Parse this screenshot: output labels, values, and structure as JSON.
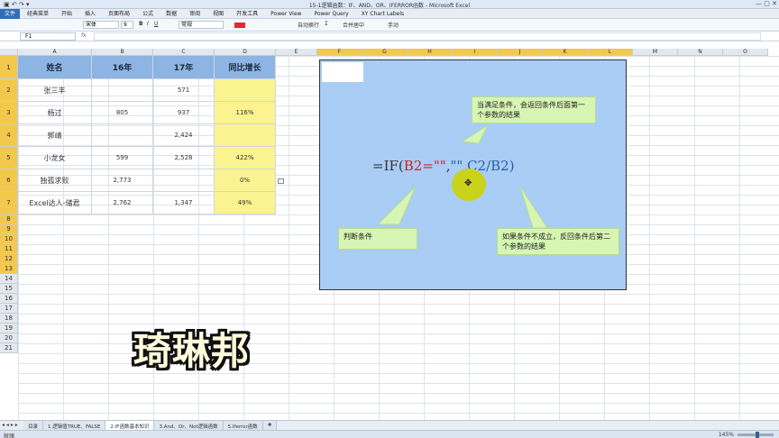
{
  "window": {
    "title": "15-1逻辑函数：IF、AND、OR、IFERROR函数 - Microsoft Excel",
    "quick_access": "▣ ↶ ↷ ▾",
    "controls": "— ▢ ✕"
  },
  "menu": {
    "file": "文件",
    "tabs": [
      "经典菜单",
      "开始",
      "插入",
      "页面布局",
      "公式",
      "数据",
      "审阅",
      "视图",
      "开发工具",
      "Power View",
      "Power Query",
      "XY Chart Labels"
    ]
  },
  "ribbon": {
    "font_name": "宋体",
    "font_size": "9",
    "bold": "B",
    "italic": "I",
    "underline": "U",
    "wrap": "自动换行",
    "merge": "合并居中",
    "format": "常规",
    "sum": "Σ",
    "hand": "手动"
  },
  "formula_bar": {
    "name_box": "F1",
    "fx_label": "fx",
    "formula": ""
  },
  "columns": [
    "A",
    "B",
    "C",
    "D",
    "E",
    "F",
    "G",
    "H",
    "I",
    "J",
    "K",
    "L",
    "M",
    "N",
    "O"
  ],
  "rows": [
    "1",
    "2",
    "3",
    "4",
    "5",
    "6",
    "7",
    "8",
    "9",
    "10",
    "11",
    "12",
    "13",
    "14",
    "15",
    "16",
    "17",
    "18",
    "19",
    "20",
    "21"
  ],
  "table": {
    "headers": [
      "姓名",
      "16年",
      "17年",
      "同比增长"
    ],
    "rows": [
      [
        "张三丰",
        "",
        "571",
        ""
      ],
      [
        "杨过",
        "805",
        "937",
        "116%"
      ],
      [
        "郭靖",
        "",
        "2,424",
        ""
      ],
      [
        "小龙女",
        "599",
        "2,528",
        "422%"
      ],
      [
        "独孤求败",
        "2,773",
        "",
        "0%"
      ],
      [
        "Excel达人-储君",
        "2,762",
        "1,347",
        "49%"
      ]
    ]
  },
  "diagram": {
    "callout_top": "当满足条件，会返回条件后面第一个参数的结果",
    "callout_left": "判断条件",
    "callout_right": "如果条件不成立，反回条件后第二个参数的结果",
    "formula_prefix": "=IF(",
    "formula_cond": "B2=\"\"",
    "formula_comma1": ",",
    "formula_true": "\"\"",
    "formula_rest": ",C2/B2)"
  },
  "overlay_text": "琦琳邦",
  "sheet_tabs": {
    "nav": "◂ ◂ ▸ ▸",
    "tabs": [
      "目录",
      "1.逻辑值TRUE、FALSE",
      "2.IF函数基本知识",
      "3.And、Or、Not逻辑函数",
      "5.Iferror函数",
      "✚"
    ],
    "active_index": 2
  },
  "status": {
    "ready": "就绪",
    "zoom": "145%",
    "zoom_level": 0.55
  },
  "colors": {
    "header_blue": "#8db4e2",
    "yellow": "#fbf38f",
    "callout_green": "#d7f5b3",
    "diagram_bg": "#a9cdf4",
    "selection": "#f3c94c"
  }
}
